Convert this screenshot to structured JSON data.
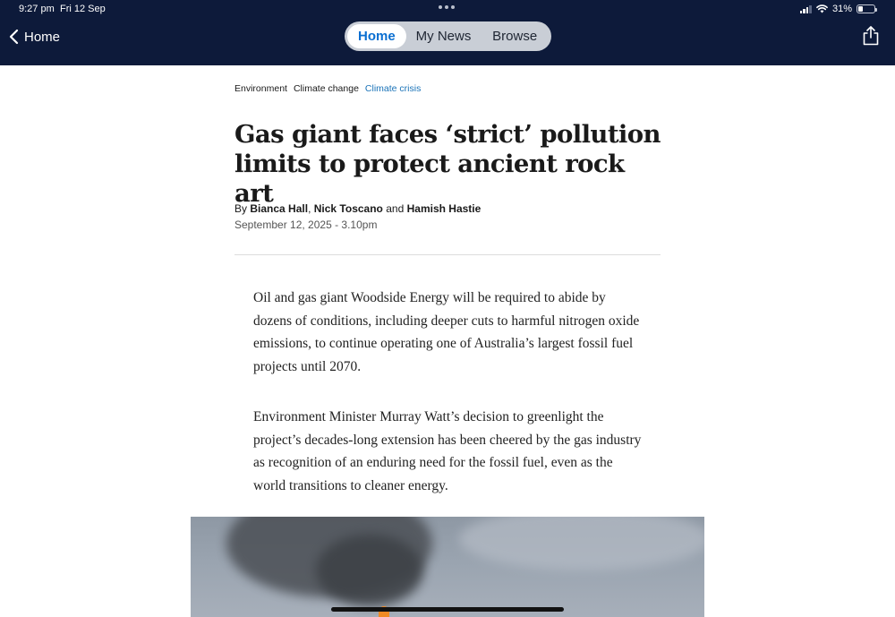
{
  "status_bar": {
    "time": "9:27 pm",
    "date": "Fri 12 Sep",
    "battery": "31%",
    "battery_level": 0.31
  },
  "nav": {
    "back_label": "Home",
    "tabs": [
      {
        "label": "Home",
        "active": true
      },
      {
        "label": "My News",
        "active": false
      },
      {
        "label": "Browse",
        "active": false
      }
    ]
  },
  "article": {
    "breadcrumbs": [
      "Environment",
      "Climate change",
      "Climate crisis"
    ],
    "headline": "Gas giant faces ‘strict’ pollution limits to protect ancient rock art",
    "byline": {
      "prefix": "By",
      "author1": "Bianca Hall",
      "sep1": ",",
      "author2": "Nick Toscano",
      "sep2": "and",
      "author3": "Hamish Hastie"
    },
    "date": "September 12, 2025 - 3.10pm",
    "paragraphs": [
      "Oil and gas giant Woodside Energy will be required to abide by dozens of conditions, including deeper cuts to harmful nitrogen oxide emissions, to continue operating one of Australia’s largest fossil fuel projects until 2070.",
      "Environment Minister Murray Watt’s decision to greenlight the project’s decades-long extension has been cheered by the gas industry as recognition of an enduring need for the fossil fuel, even as the world transitions to cleaner energy."
    ]
  },
  "colors": {
    "topbar": "#0d1a3a",
    "accent": "#0b6fd1",
    "link": "#1a73b8"
  },
  "icons": {
    "back": "chevron-left-icon",
    "share": "share-icon"
  }
}
